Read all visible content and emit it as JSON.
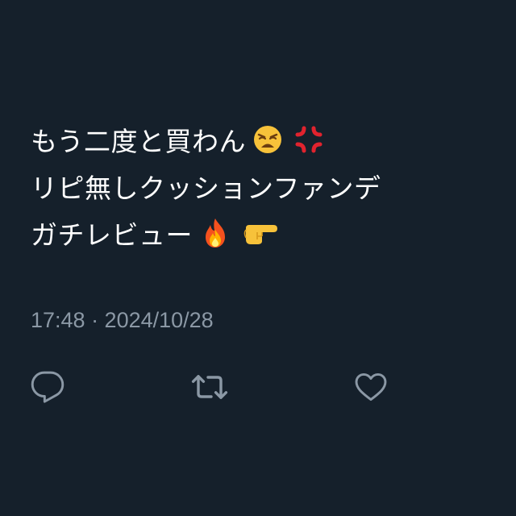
{
  "tweet": {
    "lines": [
      {
        "text": "もう二度と買わん",
        "emojis": [
          "weary-face-icon",
          "anger-symbol-icon"
        ]
      },
      {
        "text": "リピ無しクッションファンデ",
        "emojis": []
      },
      {
        "text": "ガチレビュー",
        "emojis": [
          "fire-icon",
          "backhand-index-pointing-right-icon"
        ]
      }
    ],
    "timestamp": "17:48 · 2024/10/28"
  },
  "actions": {
    "icons": [
      "reply-icon",
      "retweet-icon",
      "like-icon"
    ]
  },
  "colors": {
    "background": "#15202b",
    "text": "#ffffff",
    "muted": "#8b98a5"
  }
}
